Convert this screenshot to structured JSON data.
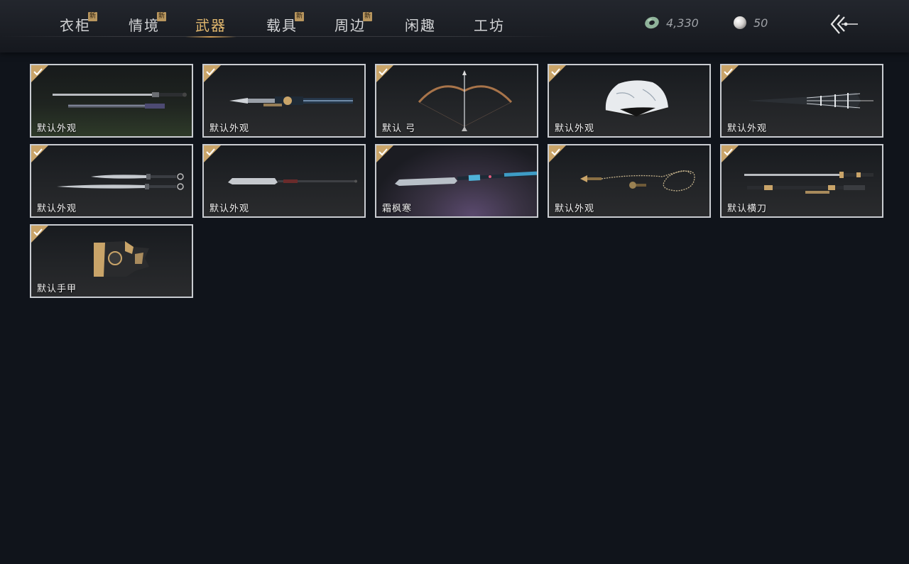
{
  "nav": {
    "tabs": [
      {
        "label": "衣柜",
        "badge": "新"
      },
      {
        "label": "情境",
        "badge": "新"
      },
      {
        "label": "武器",
        "badge": ""
      },
      {
        "label": "载具",
        "badge": "新"
      },
      {
        "label": "周边",
        "badge": "新"
      },
      {
        "label": "闲趣",
        "badge": ""
      },
      {
        "label": "工坊",
        "badge": ""
      }
    ],
    "active_tab": "武器"
  },
  "currency": {
    "coins": {
      "icon": "jade-coin-icon",
      "value": "4,330"
    },
    "pearls": {
      "icon": "pearl-icon",
      "value": "50"
    }
  },
  "back": {
    "icon": "back-arrow-icon"
  },
  "items": [
    {
      "label": "默认外观",
      "weapon": "sword-icon",
      "owned": true
    },
    {
      "label": "默认外观",
      "weapon": "ornate-spear-icon",
      "owned": true
    },
    {
      "label": "默认 弓",
      "weapon": "bow-icon",
      "owned": true
    },
    {
      "label": "默认外观",
      "weapon": "fan-icon",
      "owned": true
    },
    {
      "label": "默认外观",
      "weapon": "umbrella-icon",
      "owned": true
    },
    {
      "label": "默认外观",
      "weapon": "twin-blades-icon",
      "owned": true
    },
    {
      "label": "默认外观",
      "weapon": "glaive-icon",
      "owned": true
    },
    {
      "label": "霜枫寒",
      "weapon": "frost-spear-icon",
      "owned": true
    },
    {
      "label": "默认外观",
      "weapon": "rope-dart-icon",
      "owned": true
    },
    {
      "label": "默认横刀",
      "weapon": "hengdao-icon",
      "owned": true
    },
    {
      "label": "默认手甲",
      "weapon": "gauntlet-icon",
      "owned": true
    }
  ],
  "colors": {
    "accent": "#e2b86e",
    "badge": "#b8965e",
    "check": "#c9a469",
    "border": "#c9ccd1",
    "background": "#10141b"
  }
}
